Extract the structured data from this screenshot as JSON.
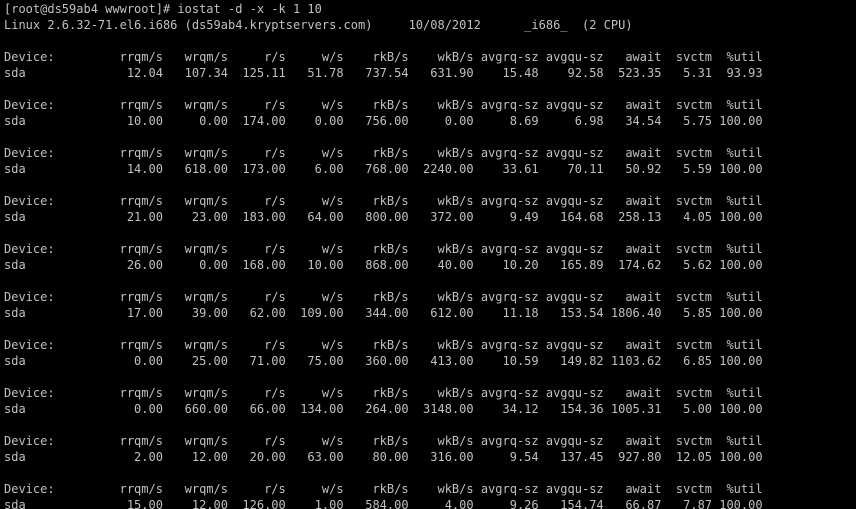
{
  "colors": {
    "background": "#000000",
    "foreground": "#c0c0c0"
  },
  "terminal": {
    "lines": [
      "[root@ds59ab4 wwwroot]# iostat -d -x -k 1 10",
      "Linux 2.6.32-71.el6.i686 (ds59ab4.kryptservers.com)     10/08/2012      _i686_  (2 CPU)",
      "",
      "Device:         rrqm/s   wrqm/s     r/s     w/s    rkB/s    wkB/s avgrq-sz avgqu-sz   await  svctm  %util",
      "sda              12.04   107.34  125.11   51.78   737.54   631.90    15.48    92.58  523.35   5.31  93.93",
      "",
      "Device:         rrqm/s   wrqm/s     r/s     w/s    rkB/s    wkB/s avgrq-sz avgqu-sz   await  svctm  %util",
      "sda              10.00     0.00  174.00    0.00   756.00     0.00     8.69     6.98   34.54   5.75 100.00",
      "",
      "Device:         rrqm/s   wrqm/s     r/s     w/s    rkB/s    wkB/s avgrq-sz avgqu-sz   await  svctm  %util",
      "sda              14.00   618.00  173.00    6.00   768.00  2240.00    33.61    70.11   50.92   5.59 100.00",
      "",
      "Device:         rrqm/s   wrqm/s     r/s     w/s    rkB/s    wkB/s avgrq-sz avgqu-sz   await  svctm  %util",
      "sda              21.00    23.00  183.00   64.00   800.00   372.00     9.49   164.68  258.13   4.05 100.00",
      "",
      "Device:         rrqm/s   wrqm/s     r/s     w/s    rkB/s    wkB/s avgrq-sz avgqu-sz   await  svctm  %util",
      "sda              26.00     0.00  168.00   10.00   868.00    40.00    10.20   165.89  174.62   5.62 100.00",
      "",
      "Device:         rrqm/s   wrqm/s     r/s     w/s    rkB/s    wkB/s avgrq-sz avgqu-sz   await  svctm  %util",
      "sda              17.00    39.00   62.00  109.00   344.00   612.00    11.18   153.54 1806.40   5.85 100.00",
      "",
      "Device:         rrqm/s   wrqm/s     r/s     w/s    rkB/s    wkB/s avgrq-sz avgqu-sz   await  svctm  %util",
      "sda               0.00    25.00   71.00   75.00   360.00   413.00    10.59   149.82 1103.62   6.85 100.00",
      "",
      "Device:         rrqm/s   wrqm/s     r/s     w/s    rkB/s    wkB/s avgrq-sz avgqu-sz   await  svctm  %util",
      "sda               0.00   660.00   66.00  134.00   264.00  3148.00    34.12   154.36 1005.31   5.00 100.00",
      "",
      "Device:         rrqm/s   wrqm/s     r/s     w/s    rkB/s    wkB/s avgrq-sz avgqu-sz   await  svctm  %util",
      "sda               2.00    12.00   20.00   63.00    80.00   316.00     9.54   137.45  927.80  12.05 100.00",
      "",
      "Device:         rrqm/s   wrqm/s     r/s     w/s    rkB/s    wkB/s avgrq-sz avgqu-sz   await  svctm  %util",
      "sda              15.00    12.00  126.00    1.00   584.00     4.00     9.26   154.74   66.87   7.87 100.00"
    ]
  }
}
